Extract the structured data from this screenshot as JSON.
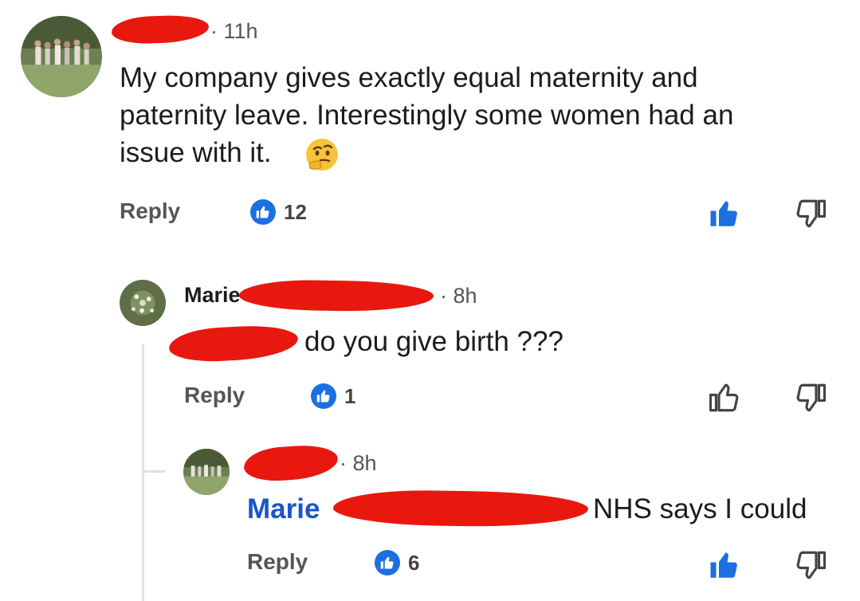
{
  "comments": [
    {
      "time": "· 11h",
      "text_lines": [
        "My company gives exactly equal maternity and",
        "paternity leave. Interestingly some women had an",
        "issue with it."
      ],
      "emoji": "thinking-face-icon",
      "reply_label": "Reply",
      "like_count": "12",
      "liked": true
    },
    {
      "author": "Marie",
      "time": "· 8h",
      "text": "do you give birth ???",
      "reply_label": "Reply",
      "like_count": "1",
      "liked": false
    },
    {
      "time": "· 8h",
      "mention": "Marie",
      "text": "NHS says I could",
      "reply_label": "Reply",
      "like_count": "6",
      "liked": true
    }
  ],
  "colors": {
    "accent": "#1b6fe0",
    "mention": "#1a55c8",
    "redaction": "#e8180f"
  }
}
